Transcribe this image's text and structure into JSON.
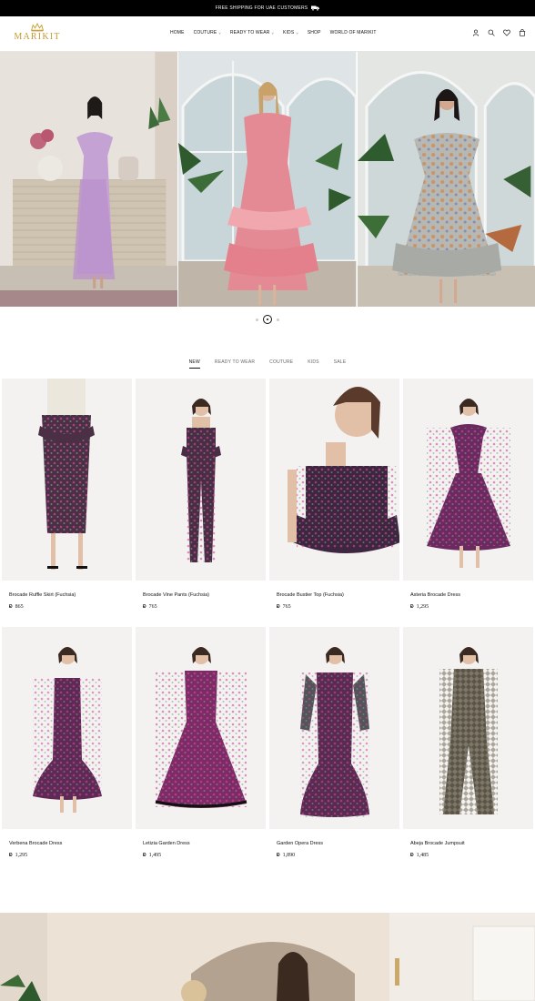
{
  "announcement": {
    "text": "FREE SHIPPING FOR UAE CUSTOMERS",
    "icon": "truck-icon"
  },
  "brand": {
    "name": "MARIKIT",
    "color": "#c59a2f"
  },
  "nav": [
    {
      "label": "HOME",
      "dropdown": false
    },
    {
      "label": "COUTURE",
      "dropdown": true
    },
    {
      "label": "READY TO WEAR",
      "dropdown": true
    },
    {
      "label": "KIDS",
      "dropdown": true
    },
    {
      "label": "SHOP",
      "dropdown": false
    },
    {
      "label": "WORLD OF MARIKIT",
      "dropdown": false
    }
  ],
  "header_icons": [
    "account-icon",
    "search-icon",
    "wishlist-icon",
    "cart-icon"
  ],
  "hero": {
    "slides": 3,
    "active_slide": 2
  },
  "tabs": [
    {
      "label": "NEW",
      "active": true
    },
    {
      "label": "READY TO WEAR",
      "active": false
    },
    {
      "label": "COUTURE",
      "active": false
    },
    {
      "label": "KIDS",
      "active": false
    },
    {
      "label": "SALE",
      "active": false
    }
  ],
  "products": [
    {
      "name": "Brocade Ruffle Skirt (Fuchsia)",
      "currency": "Đ",
      "price": "865"
    },
    {
      "name": "Brocade Vine Pants (Fuchsia)",
      "currency": "Đ",
      "price": "765"
    },
    {
      "name": "Brocade Bustier Top (Fuchsia)",
      "currency": "Đ",
      "price": "765"
    },
    {
      "name": "Asteria Brocade Dress",
      "currency": "Đ",
      "price": "1,295"
    },
    {
      "name": "Verbena Brocade Dress",
      "currency": "Đ",
      "price": "1,295"
    },
    {
      "name": "Letizia Garden Dress",
      "currency": "Đ",
      "price": "1,495"
    },
    {
      "name": "Garden Opera Dress",
      "currency": "Đ",
      "price": "1,890"
    },
    {
      "name": "Abeja Brocade Jumpsuit",
      "currency": "Đ",
      "price": "1,485"
    }
  ]
}
